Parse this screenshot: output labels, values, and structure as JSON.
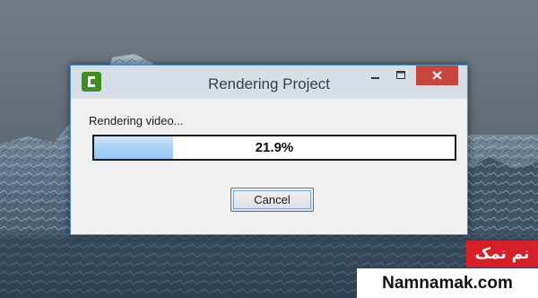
{
  "window": {
    "title": "Rendering Project",
    "app_icon": "camtasia-c-icon",
    "controls": [
      "minimize-icon",
      "maximize-icon",
      "close-icon"
    ],
    "accent_color": "#c7463b"
  },
  "dialog": {
    "status_text": "Rendering video...",
    "progress_percent": 21.9,
    "progress_label": "21.9%",
    "progress_color": "#a9d1f7",
    "cancel_label": "Cancel"
  },
  "watermark": {
    "persian": "نم نمک",
    "latin": "Namnamak.com",
    "color": "#d71f29"
  }
}
